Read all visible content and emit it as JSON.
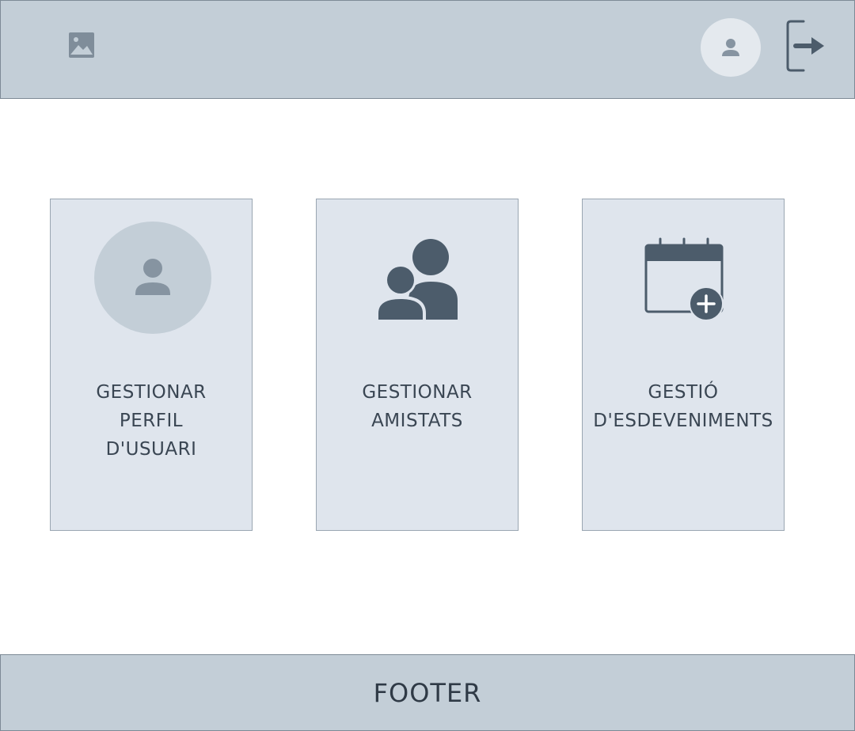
{
  "header": {
    "logo_icon": "image-placeholder-icon",
    "avatar_icon": "user-icon",
    "logout_icon": "logout-icon"
  },
  "cards": [
    {
      "label": "GESTIONAR\nPERFIL\nD'USUARI",
      "icon": "user-avatar-icon"
    },
    {
      "label": "GESTIONAR\nAMISTATS",
      "icon": "friends-icon"
    },
    {
      "label": "GESTIÓ\nD'ESDEVENIMENTS",
      "icon": "calendar-add-icon"
    }
  ],
  "footer": {
    "label": "FOOTER"
  },
  "colors": {
    "header_bg": "#c3ced7",
    "card_bg": "#dfe5ed",
    "icon_dark": "#4c5c6b",
    "icon_muted": "#8694a1"
  }
}
